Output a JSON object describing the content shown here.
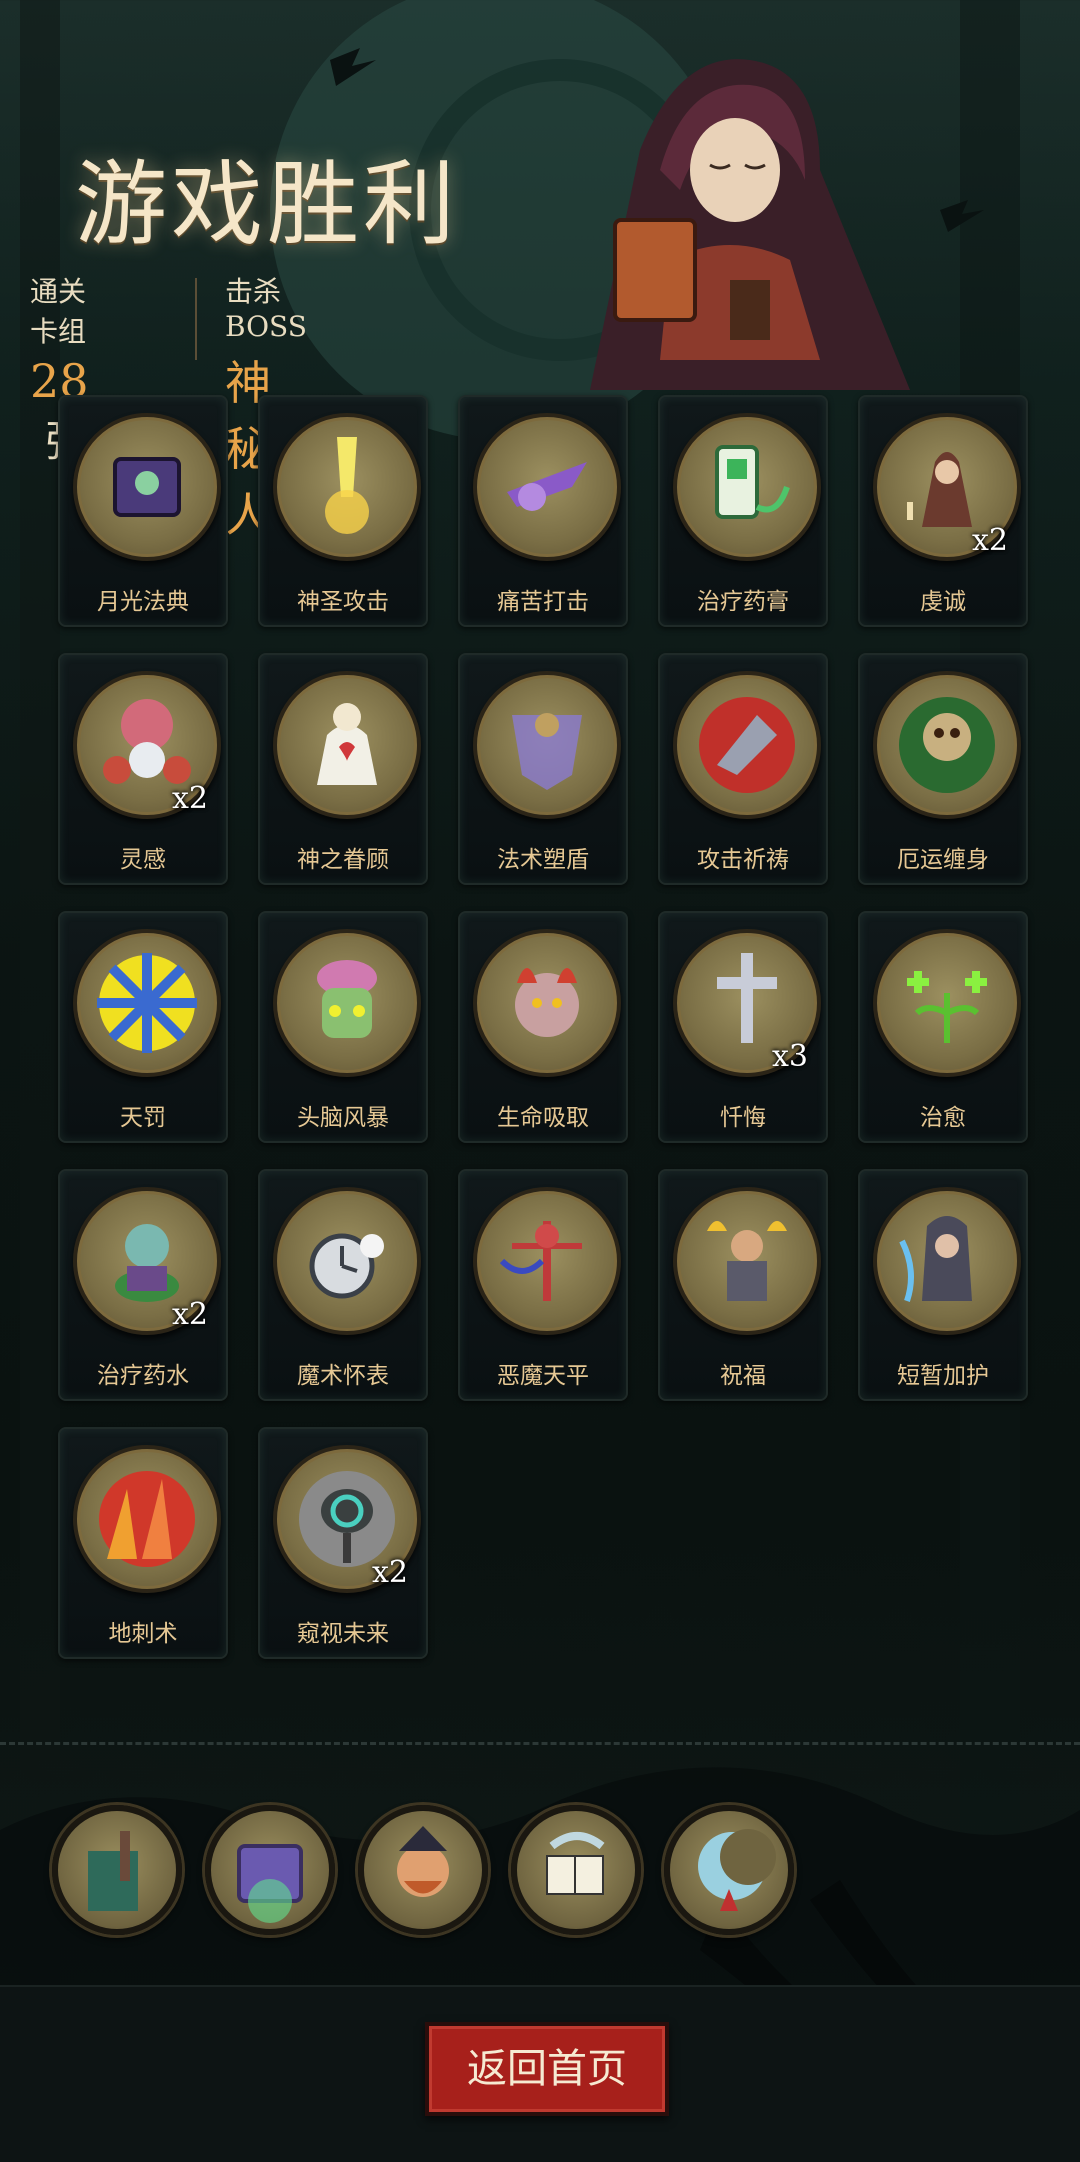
{
  "title": "游戏胜利",
  "stats": {
    "deck_label": "通关卡组",
    "deck_count": "28",
    "deck_unit": "张",
    "boss_label": "击杀BOSS",
    "boss_name": "神秘人"
  },
  "cards": [
    {
      "name": "月光法典",
      "icon": "moonlight-codex-icon",
      "count": ""
    },
    {
      "name": "神圣攻击",
      "icon": "holy-strike-icon",
      "count": ""
    },
    {
      "name": "痛苦打击",
      "icon": "pain-strike-icon",
      "count": ""
    },
    {
      "name": "治疗药膏",
      "icon": "healing-ointment-icon",
      "count": ""
    },
    {
      "name": "虔诚",
      "icon": "piety-icon",
      "count": "x2"
    },
    {
      "name": "灵感",
      "icon": "inspiration-icon",
      "count": "x2"
    },
    {
      "name": "神之眷顾",
      "icon": "divine-favor-icon",
      "count": ""
    },
    {
      "name": "法术塑盾",
      "icon": "spell-shield-icon",
      "count": ""
    },
    {
      "name": "攻击祈祷",
      "icon": "attack-prayer-icon",
      "count": ""
    },
    {
      "name": "厄运缠身",
      "icon": "doom-curse-icon",
      "count": ""
    },
    {
      "name": "天罚",
      "icon": "heaven-punishment-icon",
      "count": ""
    },
    {
      "name": "头脑风暴",
      "icon": "brainstorm-icon",
      "count": ""
    },
    {
      "name": "生命吸取",
      "icon": "life-drain-icon",
      "count": ""
    },
    {
      "name": "忏悔",
      "icon": "repentance-icon",
      "count": "x3"
    },
    {
      "name": "治愈",
      "icon": "cure-icon",
      "count": ""
    },
    {
      "name": "治疗药水",
      "icon": "healing-potion-icon",
      "count": "x2"
    },
    {
      "name": "魔术怀表",
      "icon": "magic-pocket-watch-icon",
      "count": ""
    },
    {
      "name": "恶魔天平",
      "icon": "demon-scale-icon",
      "count": ""
    },
    {
      "name": "祝福",
      "icon": "blessing-icon",
      "count": ""
    },
    {
      "name": "短暂加护",
      "icon": "brief-protection-icon",
      "count": ""
    },
    {
      "name": "地刺术",
      "icon": "ground-spikes-icon",
      "count": ""
    },
    {
      "name": "窥视未来",
      "icon": "peek-future-icon",
      "count": "x2"
    }
  ],
  "relics": [
    {
      "icon": "grave-relic-icon"
    },
    {
      "icon": "treasure-chest-relic-icon"
    },
    {
      "icon": "pirate-relic-icon"
    },
    {
      "icon": "playing-cards-relic-icon"
    },
    {
      "icon": "crescent-moon-relic-icon"
    }
  ],
  "home_button": "返回首页",
  "colors": {
    "accent": "#e8a44a",
    "button": "#a7201b",
    "card_label": "#e6c894"
  }
}
